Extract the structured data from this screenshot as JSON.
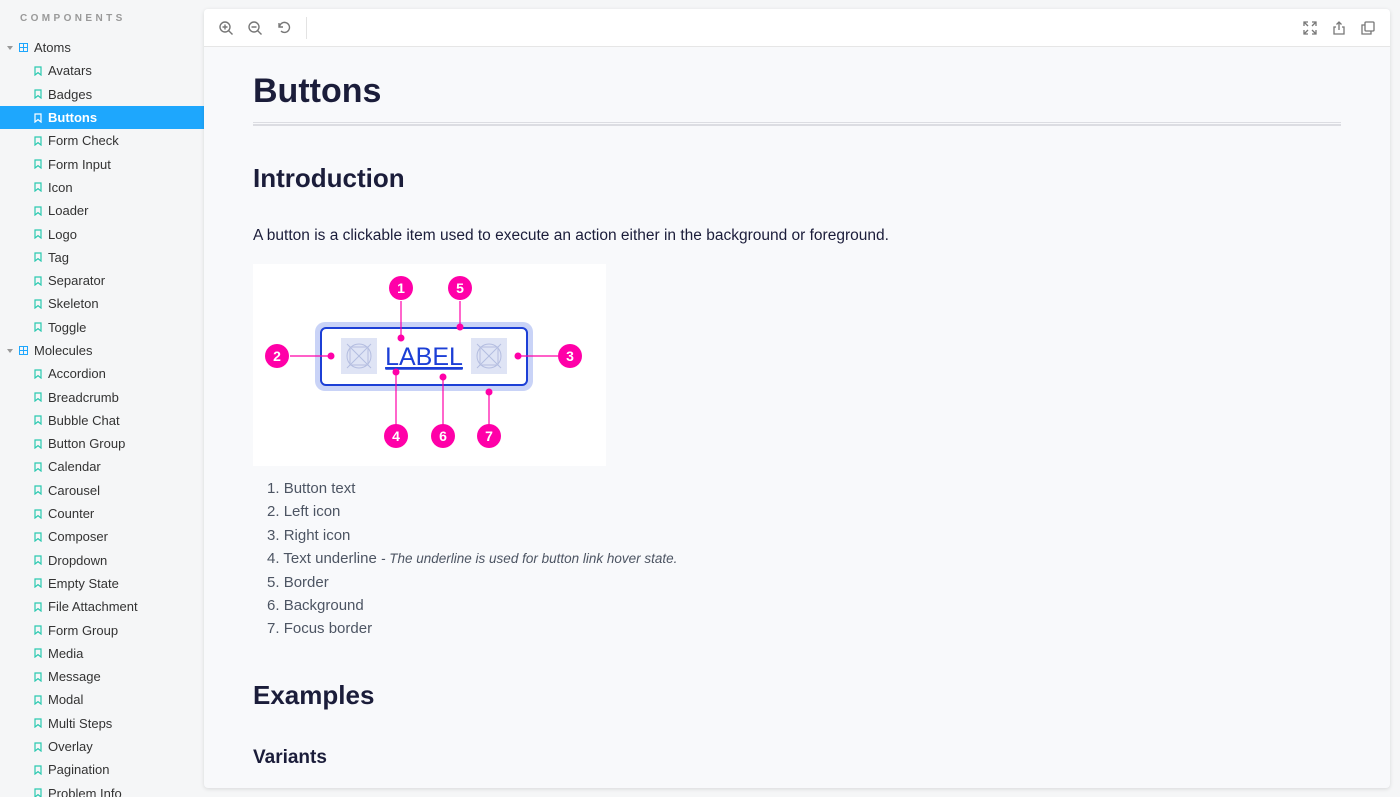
{
  "sidebar": {
    "header": "COMPONENTS",
    "groups": [
      {
        "label": "Atoms",
        "items": [
          "Avatars",
          "Badges",
          "Buttons",
          "Form Check",
          "Form Input",
          "Icon",
          "Loader",
          "Logo",
          "Tag",
          "Separator",
          "Skeleton",
          "Toggle"
        ]
      },
      {
        "label": "Molecules",
        "items": [
          "Accordion",
          "Breadcrumb",
          "Bubble Chat",
          "Button Group",
          "Calendar",
          "Carousel",
          "Counter",
          "Composer",
          "Dropdown",
          "Empty State",
          "File Attachment",
          "Form Group",
          "Media",
          "Message",
          "Modal",
          "Multi Steps",
          "Overlay",
          "Pagination",
          "Problem Info"
        ]
      }
    ],
    "selected": "Buttons"
  },
  "toolbar": {
    "left_icons": [
      "zoom-in-icon",
      "zoom-out-icon",
      "reset-zoom-icon"
    ],
    "right_icons": [
      "fullscreen-icon",
      "share-icon",
      "copy-icon"
    ]
  },
  "doc": {
    "title": "Buttons",
    "intro_heading": "Introduction",
    "intro_text": "A button is a clickable item used to execute an action either in the background or foreground.",
    "diagram": {
      "button_label": "LABEL",
      "markers": [
        "1",
        "2",
        "3",
        "4",
        "5",
        "6",
        "7"
      ],
      "accent_color": "#ff00a8",
      "button_border_color": "#1c3fd6",
      "focus_border_color": "#c9d3f7"
    },
    "legend": [
      {
        "number": "1.",
        "text": "Button text",
        "note": ""
      },
      {
        "number": "2.",
        "text": "Left icon",
        "note": ""
      },
      {
        "number": "3.",
        "text": "Right icon",
        "note": ""
      },
      {
        "number": "4.",
        "text": "Text underline",
        "note": "- The underline is used for button link hover state."
      },
      {
        "number": "5.",
        "text": "Border",
        "note": ""
      },
      {
        "number": "6.",
        "text": "Background",
        "note": ""
      },
      {
        "number": "7.",
        "text": "Focus border",
        "note": ""
      }
    ],
    "examples_heading": "Examples",
    "variants_heading": "Variants"
  },
  "colors": {
    "selected_bg": "#1ea7fd",
    "heading": "#1b1d3a",
    "bookmark_icon": "#2ac9b0"
  }
}
